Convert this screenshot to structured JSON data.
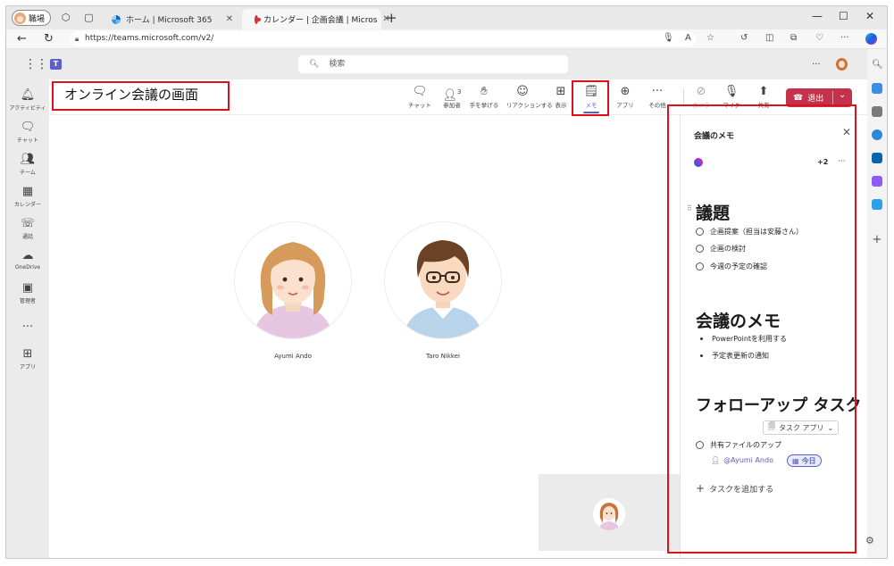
{
  "browser": {
    "profile_label": "職場",
    "tabs": [
      {
        "title": "ホーム | Microsoft 365"
      },
      {
        "title": "カレンダー | 企画会議 | Micros"
      }
    ],
    "url": "https://teams.microsoft.com/v2/"
  },
  "teams": {
    "search_placeholder": "検索",
    "top_more": "...",
    "rail": [
      {
        "label": "アクティビティ",
        "icon": "bell-icon"
      },
      {
        "label": "チャット",
        "icon": "chat-icon"
      },
      {
        "label": "チーム",
        "icon": "teams-icon"
      },
      {
        "label": "カレンダー",
        "icon": "calendar-icon"
      },
      {
        "label": "通話",
        "icon": "phone-icon"
      },
      {
        "label": "OneDrive",
        "icon": "cloud-icon"
      },
      {
        "label": "管理者",
        "icon": "admin-icon"
      },
      {
        "label": "...",
        "icon": "more-icon"
      },
      {
        "label": "アプリ",
        "icon": "apps-icon"
      }
    ]
  },
  "meeting": {
    "callout_title": "オンライン会議の画面",
    "controls": [
      {
        "label": "チャット",
        "icon": "chat-icon",
        "badge": ""
      },
      {
        "label": "参加者",
        "icon": "people-icon",
        "badge": "3"
      },
      {
        "label": "手を挙げる",
        "icon": "raise-hand-icon",
        "badge": ""
      },
      {
        "label": "リアクションする",
        "icon": "smile-icon",
        "badge": ""
      },
      {
        "label": "表示",
        "icon": "view-icon",
        "badge": ""
      },
      {
        "label": "メモ",
        "icon": "notes-icon",
        "badge": ""
      },
      {
        "label": "アプリ",
        "icon": "add-app-icon",
        "badge": ""
      },
      {
        "label": "その他",
        "icon": "more-icon",
        "badge": ""
      },
      {
        "label": "カメラ",
        "icon": "camera-off-icon",
        "badge": ""
      },
      {
        "label": "マイク",
        "icon": "mic-off-icon",
        "badge": ""
      },
      {
        "label": "共有",
        "icon": "share-icon",
        "badge": ""
      }
    ],
    "leave_label": "退出",
    "participants": [
      {
        "name": "Ayumi Ando"
      },
      {
        "name": "Taro Nikkei"
      }
    ]
  },
  "notes": {
    "title": "会議のメモ",
    "collaborators": "+2",
    "more": "···",
    "agenda_heading": "議題",
    "agenda_items": [
      "企画提案（担当は安藤さん）",
      "企画の検討",
      "今週の予定の確認"
    ],
    "memo_heading": "会議のメモ",
    "memo_items": [
      "PowerPointを利用する",
      "予定表更新の通知"
    ],
    "followup_heading": "フォローアップ タスク",
    "task_app_label": "タスク アプリ",
    "task_item": "共有ファイルのアップ",
    "task_assignee": "@Ayumi Ando",
    "task_due": "今日",
    "add_task_label": "タスクを追加する"
  },
  "colors": {
    "teams_purple": "#5b5fc7",
    "leave_red": "#c4314b",
    "callout_red": "#e0101a"
  }
}
